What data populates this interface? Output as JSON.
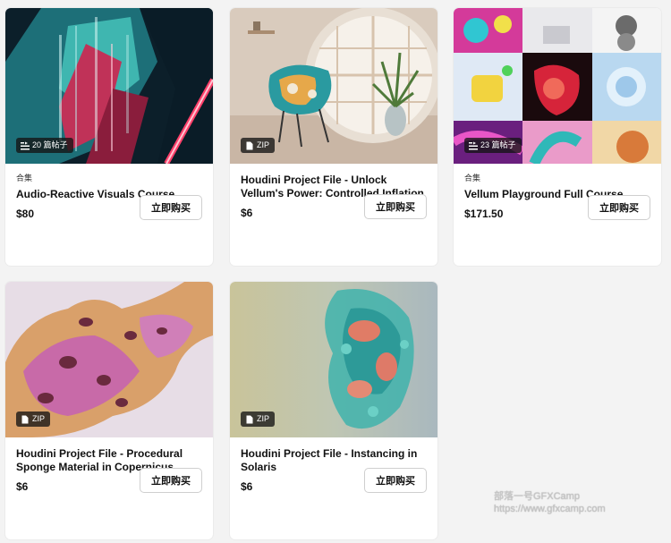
{
  "products": [
    {
      "kind": "合集",
      "badge": "20 篇帖子",
      "badge_icon": "list-icon",
      "title": "Audio-Reactive Visuals Course",
      "price": "$80",
      "buy": "立即购买"
    },
    {
      "kind": "",
      "badge": "ZIP",
      "badge_icon": "file-icon",
      "title": "Houdini Project File - Unlock Vellum's Power: Controlled Inflation",
      "price": "$6",
      "buy": "立即购买"
    },
    {
      "kind": "合集",
      "badge": "23 篇帖子",
      "badge_icon": "list-icon",
      "title": "Vellum Playground Full Course",
      "price": "$171.50",
      "buy": "立即购买"
    },
    {
      "kind": "",
      "badge": "ZIP",
      "badge_icon": "file-icon",
      "title": "Houdini Project File - Procedural Sponge Material in Copernicus",
      "price": "$6",
      "buy": "立即购买"
    },
    {
      "kind": "",
      "badge": "ZIP",
      "badge_icon": "file-icon",
      "title": "Houdini Project File - Instancing in Solaris",
      "price": "$6",
      "buy": "立即购买"
    }
  ],
  "watermark": {
    "line1": "部落一号GFXCamp",
    "line2": "https://www.gfxcamp.com"
  }
}
